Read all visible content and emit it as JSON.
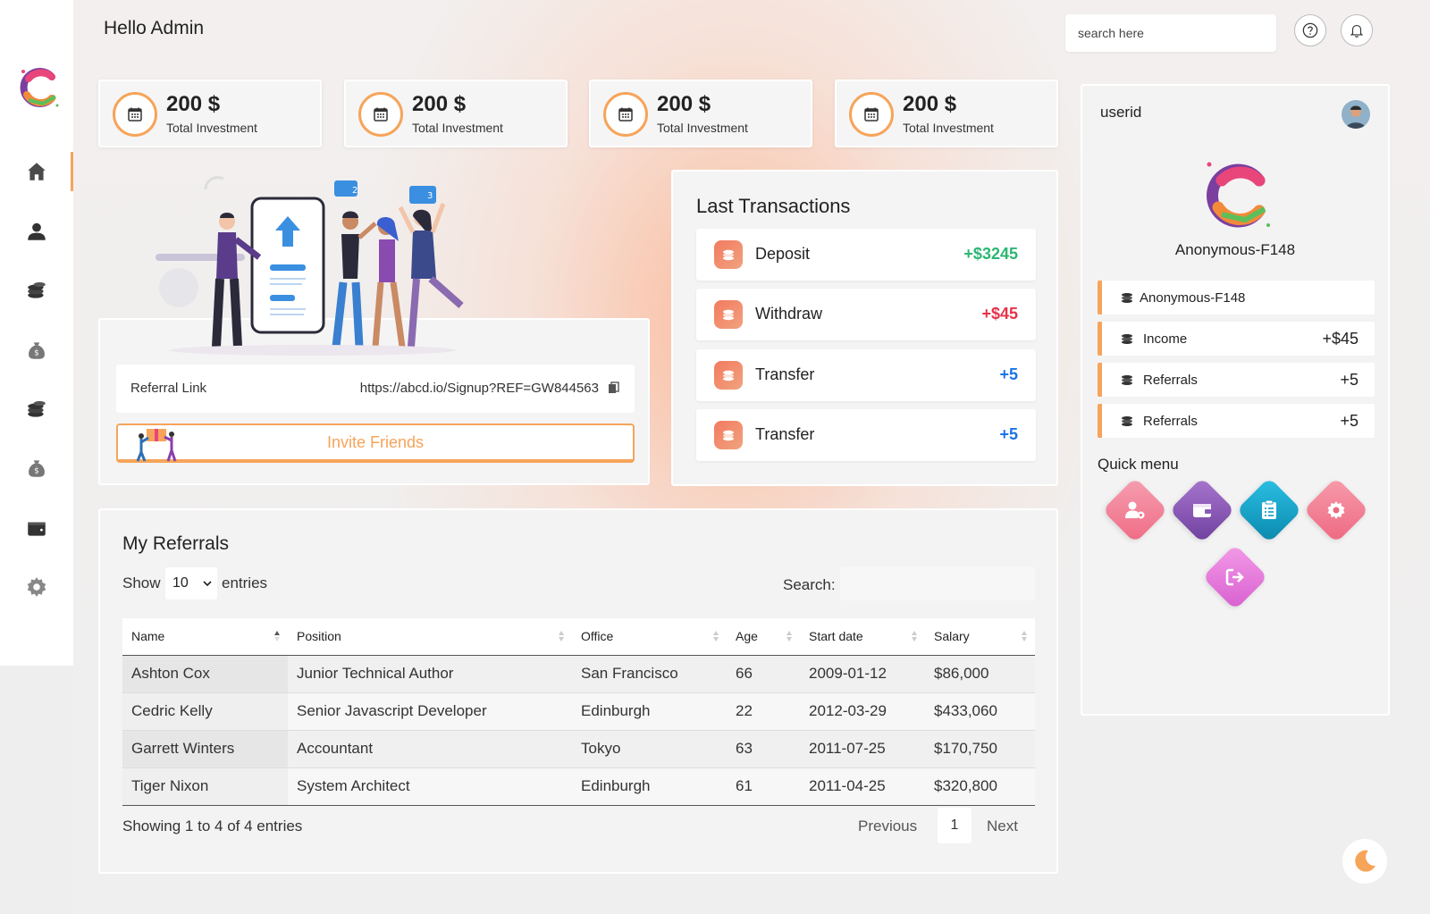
{
  "header": {
    "greeting": "Hello Admin",
    "search_placeholder": "search here"
  },
  "sidebar": {
    "items": [
      {
        "icon": "home-icon",
        "active": true
      },
      {
        "icon": "user-icon",
        "active": false
      },
      {
        "icon": "coins-icon",
        "active": false
      },
      {
        "icon": "money-bag-icon",
        "active": false
      },
      {
        "icon": "coins-icon",
        "active": false
      },
      {
        "icon": "money-bag-icon",
        "active": false
      },
      {
        "icon": "wallet-icon",
        "active": false
      },
      {
        "icon": "gear-icon",
        "active": false
      }
    ]
  },
  "stats": [
    {
      "value": "200 $",
      "label": "Total Investment"
    },
    {
      "value": "200 $",
      "label": "Total Investment"
    },
    {
      "value": "200 $",
      "label": "Total Investment"
    },
    {
      "value": "200 $",
      "label": "Total Investment"
    }
  ],
  "referral": {
    "label": "Referral Link",
    "link": "https://abcd.io/Signup?REF=GW844563",
    "invite_label": "Invite Friends"
  },
  "transactions": {
    "title": "Last Transactions",
    "items": [
      {
        "name": "Deposit",
        "amount": "+$3245",
        "color": "#2bb673"
      },
      {
        "name": "Withdraw",
        "amount": "+$45",
        "color": "#e5334b"
      },
      {
        "name": "Transfer",
        "amount": "+5",
        "color": "#1a73e8"
      },
      {
        "name": "Transfer",
        "amount": "+5",
        "color": "#1a73e8"
      }
    ]
  },
  "referrals_table": {
    "title": "My Referrals",
    "show_label": "Show",
    "entries_label": "entries",
    "page_length": "10",
    "search_label": "Search:",
    "columns": [
      "Name",
      "Position",
      "Office",
      "Age",
      "Start date",
      "Salary"
    ],
    "rows": [
      [
        "Ashton Cox",
        "Junior Technical Author",
        "San Francisco",
        "66",
        "2009-01-12",
        "$86,000"
      ],
      [
        "Cedric Kelly",
        "Senior Javascript Developer",
        "Edinburgh",
        "22",
        "2012-03-29",
        "$433,060"
      ],
      [
        "Garrett Winters",
        "Accountant",
        "Tokyo",
        "63",
        "2011-07-25",
        "$170,750"
      ],
      [
        "Tiger Nixon",
        "System Architect",
        "Edinburgh",
        "61",
        "2011-04-25",
        "$320,800"
      ]
    ],
    "info": "Showing 1 to 4 of 4 entries",
    "previous": "Previous",
    "page": "1",
    "next": "Next"
  },
  "profile": {
    "userid_label": "userid",
    "name": "Anonymous-F148",
    "rows": [
      {
        "label": "Anonymous-F148",
        "value": ""
      },
      {
        "label": "Income",
        "value": "+$45"
      },
      {
        "label": "Referrals",
        "value": "+5"
      },
      {
        "label": "Referrals",
        "value": "+5"
      }
    ],
    "quick_menu_title": "Quick menu",
    "quick_menu": [
      {
        "icon": "user-settings-icon",
        "color": "#f27b93"
      },
      {
        "icon": "wallet-icon",
        "color": "#8a5bb5"
      },
      {
        "icon": "clipboard-icon",
        "color": "#1aa3c8"
      },
      {
        "icon": "gear-icon",
        "color": "#f2788f"
      },
      {
        "icon": "logout-icon",
        "color": "#e873d8"
      }
    ]
  },
  "colors": {
    "accent": "#f6a45a",
    "positive": "#2bb673",
    "negative": "#e5334b",
    "info": "#1a73e8"
  }
}
